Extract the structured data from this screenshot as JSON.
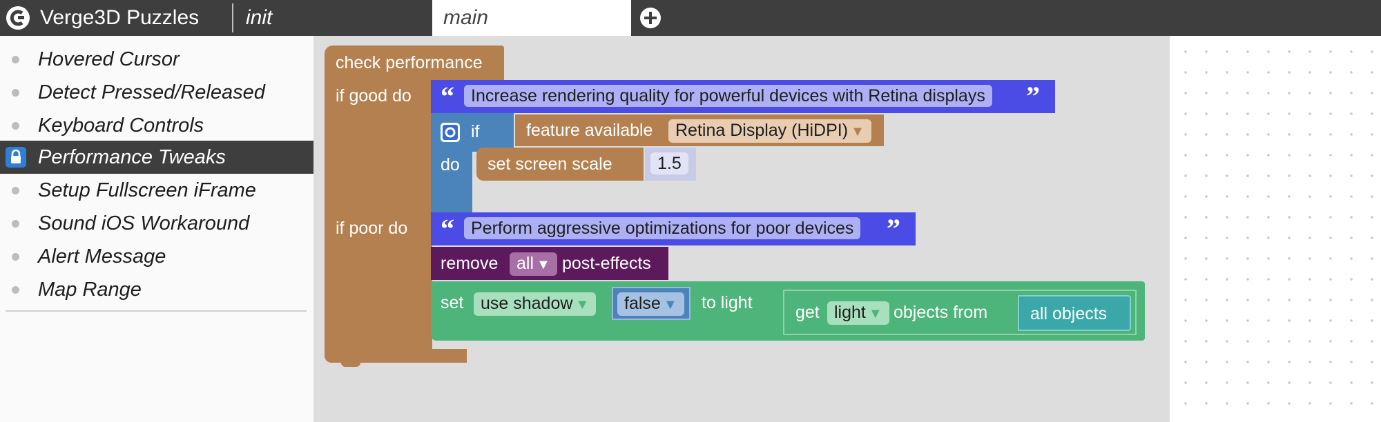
{
  "app": {
    "title": "Verge3D Puzzles"
  },
  "tabs": [
    {
      "label": "init"
    },
    {
      "label": "main"
    }
  ],
  "sidebar": {
    "items": [
      {
        "label": "Hovered Cursor"
      },
      {
        "label": "Detect Pressed/Released"
      },
      {
        "label": "Keyboard Controls"
      },
      {
        "label": "Performance Tweaks"
      },
      {
        "label": "Setup Fullscreen iFrame"
      },
      {
        "label": "Sound iOS Workaround"
      },
      {
        "label": "Alert Message"
      },
      {
        "label": "Map Range"
      }
    ]
  },
  "blocks": {
    "check_perf": {
      "title": "check performance",
      "good_label": "if good do",
      "poor_label": "if poor do"
    },
    "comment1": {
      "text": "Increase rendering quality for powerful devices with Retina displays"
    },
    "if_block": {
      "if_label": "if",
      "do_label": "do"
    },
    "feature": {
      "label": "feature available",
      "value": "Retina Display (HiDPI)"
    },
    "screen_scale": {
      "label": "set screen scale",
      "value": "1.5"
    },
    "comment2": {
      "text": "Perform aggressive optimizations for poor devices"
    },
    "remove": {
      "label": "remove",
      "value": "all",
      "suffix": "post-effects"
    },
    "set_light": {
      "label": "set",
      "prop": "use shadow",
      "value": "false",
      "to_label": "to light"
    },
    "get_objects": {
      "label": "get",
      "type": "light",
      "from_label": "objects from",
      "source": "all objects"
    }
  },
  "colors": {
    "topbar": "#3e3e3e",
    "brown": "#b5804f",
    "blue": "#4a84bb",
    "purple": "#4b4ce5",
    "maroon": "#5c1a5c",
    "green": "#4db57a",
    "teal": "#3aa8a8"
  }
}
